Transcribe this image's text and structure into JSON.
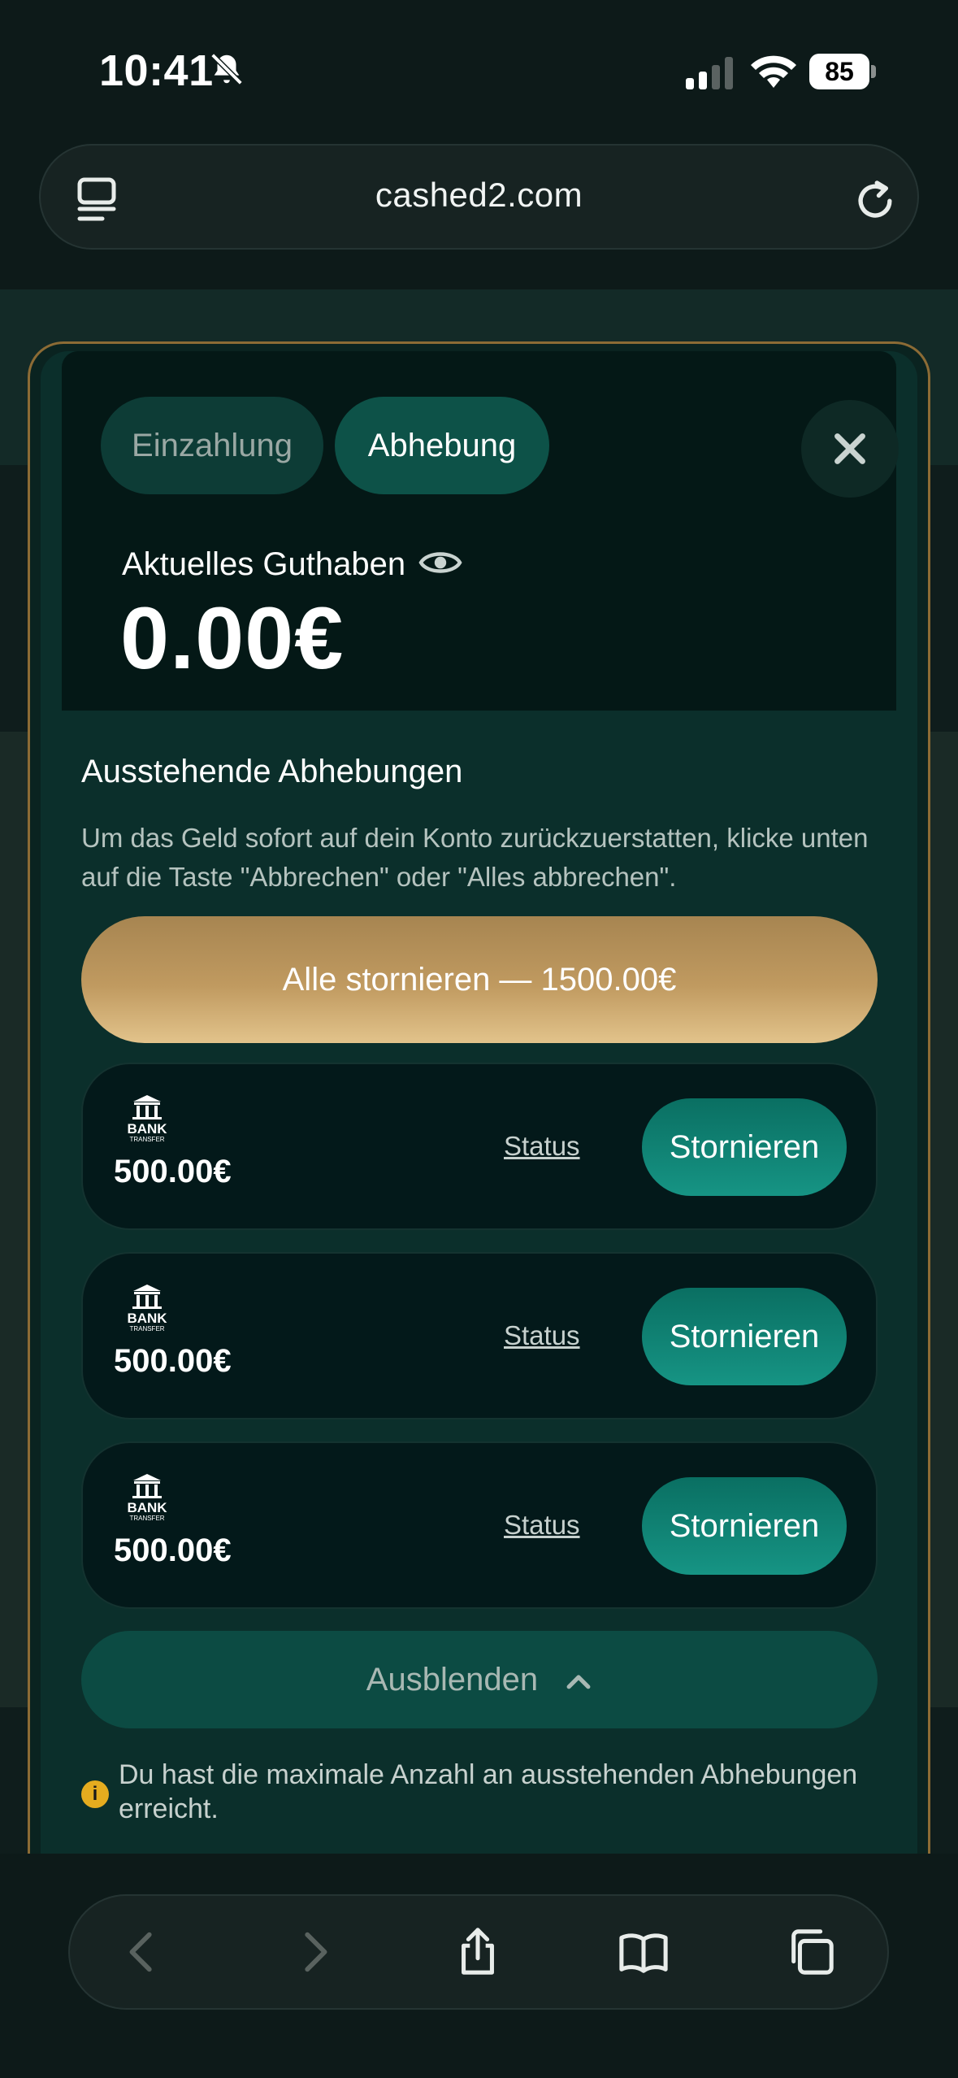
{
  "status_bar": {
    "time": "10:41",
    "battery": "85"
  },
  "browser": {
    "url": "cashed2.com"
  },
  "modal": {
    "tabs": [
      {
        "label": "Einzahlung"
      },
      {
        "label": "Abhebung"
      }
    ],
    "balance_label": "Aktuelles Guthaben",
    "balance_value": "0.00€",
    "section_title": "Ausstehende Abhebungen",
    "section_description": "Um das Geld sofort auf dein Konto zurückzuerstatten, klicke unten auf die Taste \"Abbrechen\" oder \"Alles abbrechen\".",
    "cancel_all_label": "Alle stornieren — 1500.00€",
    "withdrawals": [
      {
        "method_icon": "bank-transfer-icon",
        "amount": "500.00€",
        "status_label": "Status",
        "cancel_label": "Stornieren"
      },
      {
        "method_icon": "bank-transfer-icon",
        "amount": "500.00€",
        "status_label": "Status",
        "cancel_label": "Stornieren"
      },
      {
        "method_icon": "bank-transfer-icon",
        "amount": "500.00€",
        "status_label": "Status",
        "cancel_label": "Stornieren"
      }
    ],
    "hide_label": "Ausblenden",
    "info_text": "Du hast die maximale Anzahl an ausstehenden Abhebungen erreicht.",
    "bank_logo_text": "BANK",
    "bank_logo_sub": "TRANSFER"
  },
  "colors": {
    "accent_gold": "#c09a60",
    "accent_teal": "#169484",
    "info_yellow": "#e5ac1f"
  }
}
